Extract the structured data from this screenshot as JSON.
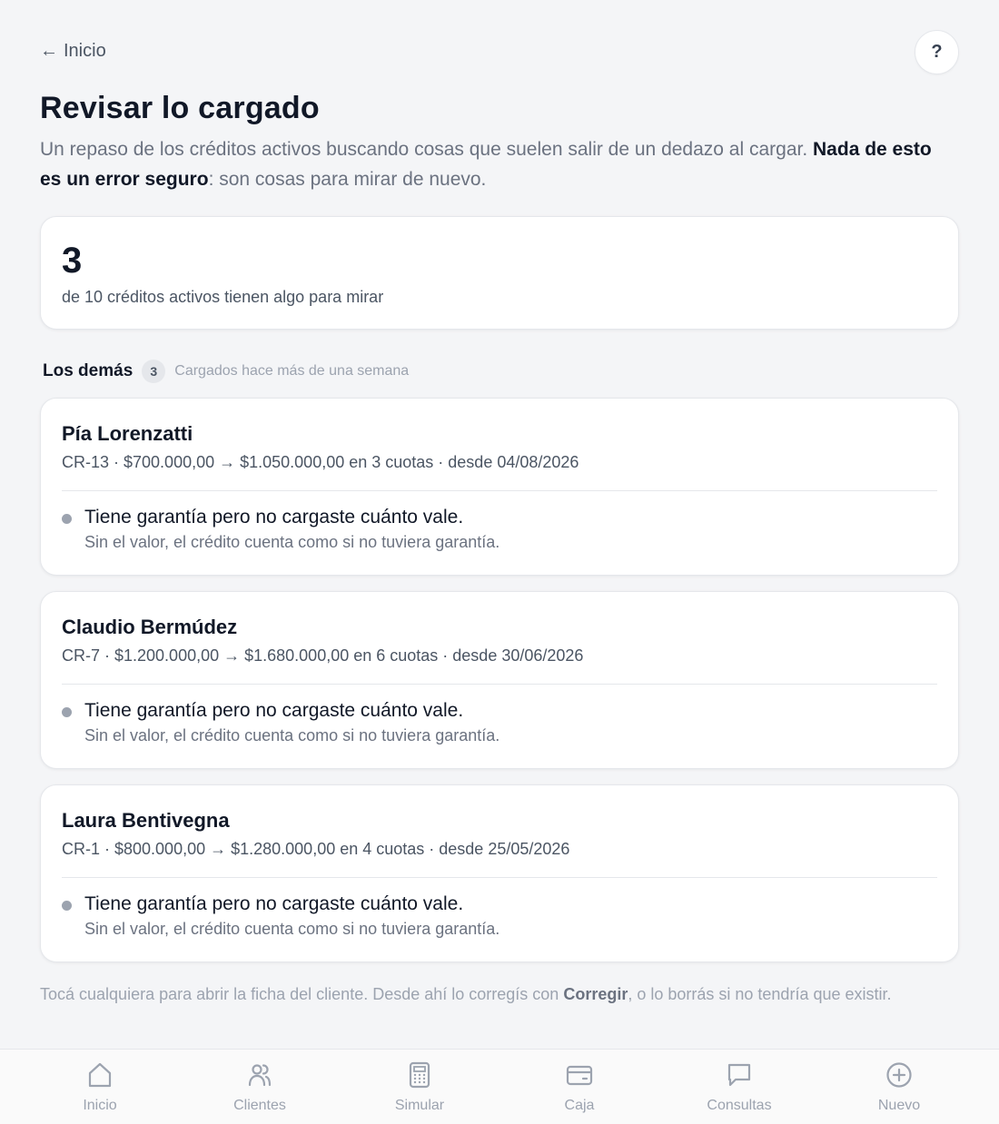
{
  "nav_top": {
    "back_label": "Inicio",
    "help_label": "?"
  },
  "page": {
    "title": "Revisar lo cargado",
    "intro_text": "Un repaso de los créditos activos buscando cosas que suelen salir de un dedazo al cargar. ",
    "intro_bold": "Nada de esto es un error seguro",
    "intro_tail": ": son cosas para mirar de nuevo."
  },
  "summary": {
    "count": "3",
    "text": "de 10 créditos activos tienen algo para mirar"
  },
  "section": {
    "title": "Los demás",
    "badge": "3",
    "subtitle": "Cargados hace más de una semana"
  },
  "credits": [
    {
      "name": "Pía Lorenzatti",
      "detail": "CR-13 · $700.000,00 → $1.050.000,00 en 3 cuotas · desde 04/08/2026",
      "issue": "Tiene garantía pero no cargaste cuánto vale.",
      "issue_sub": "Sin el valor, el crédito cuenta como si no tuviera garantía."
    },
    {
      "name": "Claudio Bermúdez",
      "detail": "CR-7 · $1.200.000,00 → $1.680.000,00 en 6 cuotas · desde 30/06/2026",
      "issue": "Tiene garantía pero no cargaste cuánto vale.",
      "issue_sub": "Sin el valor, el crédito cuenta como si no tuviera garantía."
    },
    {
      "name": "Laura Bentivegna",
      "detail": "CR-1 · $800.000,00 → $1.280.000,00 en 4 cuotas · desde 25/05/2026",
      "issue": "Tiene garantía pero no cargaste cuánto vale.",
      "issue_sub": "Sin el valor, el crédito cuenta como si no tuviera garantía."
    }
  ],
  "footer": {
    "text_before": "Tocá cualquiera para abrir la ficha del cliente. Desde ahí lo corregís con ",
    "text_bold": "Corregir",
    "text_after": ", o lo borrás si no tendría que existir."
  },
  "bottom_nav": [
    {
      "label": "Inicio",
      "icon": "home-icon"
    },
    {
      "label": "Clientes",
      "icon": "users-icon"
    },
    {
      "label": "Simular",
      "icon": "calculator-icon"
    },
    {
      "label": "Caja",
      "icon": "wallet-icon"
    },
    {
      "label": "Consultas",
      "icon": "chat-icon"
    },
    {
      "label": "Nuevo",
      "icon": "plus-circle-icon"
    }
  ],
  "colors": {
    "background": "#f4f5f7",
    "card": "#ffffff",
    "text_primary": "#111827",
    "text_secondary": "#6b7280",
    "icon_muted": "#9ca3af"
  }
}
